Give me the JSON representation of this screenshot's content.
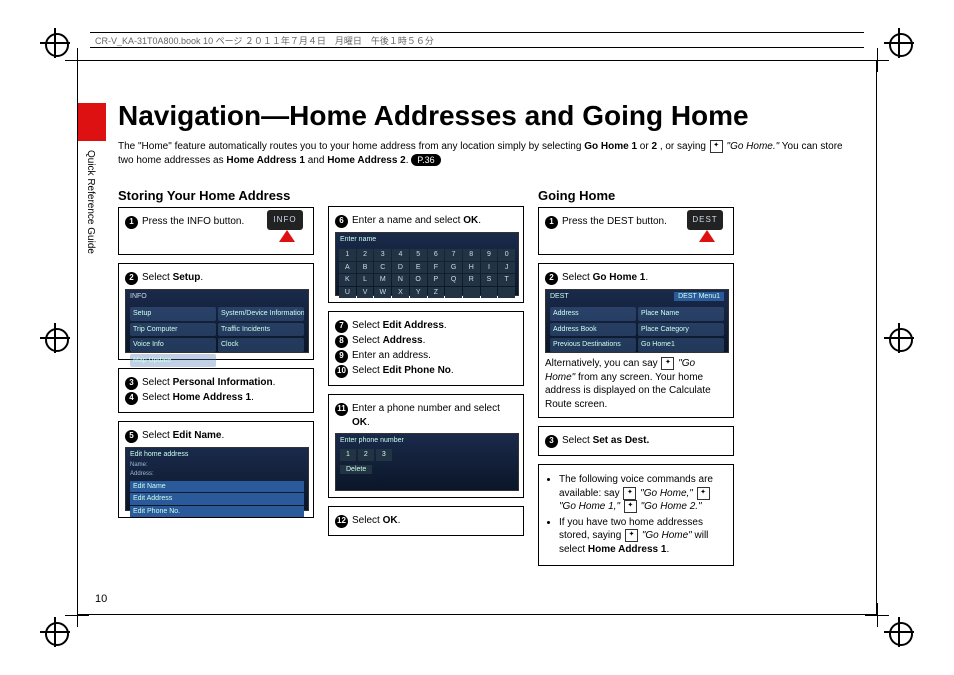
{
  "meta": {
    "header_text": "CR-V_KA-31T0A800.book  10 ページ  ２０１１年７月４日　月曜日　午後１時５６分",
    "side_tab": "Quick Reference Guide",
    "page_number": "10"
  },
  "title": "Navigation—Home Addresses and Going Home",
  "intro": {
    "line1a": "The \"Home\" feature automatically routes you to your home address from any location simply by selecting ",
    "b1": "Go Home 1",
    "mid1": " or ",
    "b2": "2",
    "mid2": ", or saying ",
    "say1": "\"Go Home.\"",
    "line2a": " You can store two home addresses as ",
    "b3": "Home Address 1",
    "mid3": " and ",
    "b4": "Home Address 2",
    "pill": "P.36"
  },
  "col1": {
    "heading": "Storing Your Home Address",
    "s1": "Press the INFO button.",
    "btn1": "INFO",
    "s2a": "Select ",
    "s2b": "Setup",
    "s2c": ".",
    "info_cells": [
      "Setup",
      "System/Device Information",
      "Trip Computer",
      "Traffic Incidents",
      "Voice Info",
      "Clock",
      "Map Update"
    ],
    "s3a": "Select ",
    "s3b": "Personal Information",
    "s3c": ".",
    "s4a": "Select ",
    "s4b": "Home Address 1",
    "s4c": ".",
    "s5a": "Select ",
    "s5b": "Edit Name",
    "s5c": ".",
    "edit_title": "Edit home address",
    "edit_rows": [
      "Edit Name",
      "Edit Address",
      "Edit Phone No."
    ]
  },
  "col2": {
    "s6a": "Enter a name and select ",
    "s6b": "OK",
    "s6c": ".",
    "kb_title": "Enter name",
    "kb": [
      "1",
      "2",
      "3",
      "4",
      "5",
      "6",
      "7",
      "8",
      "9",
      "0",
      "A",
      "B",
      "C",
      "D",
      "E",
      "F",
      "G",
      "H",
      "I",
      "J",
      "K",
      "L",
      "M",
      "N",
      "O",
      "P",
      "Q",
      "R",
      "S",
      "T",
      "U",
      "V",
      "W",
      "X",
      "Y",
      "Z",
      " ",
      " ",
      " ",
      " "
    ],
    "s7a": "Select ",
    "s7b": "Edit Address",
    "s7c": ".",
    "s8a": "Select ",
    "s8b": "Address",
    "s8c": ".",
    "s9": "Enter an address.",
    "s10a": "Select ",
    "s10b": "Edit Phone No",
    "s10c": ".",
    "s11a": "Enter a phone number and select ",
    "s11b": "OK",
    "s11c": ".",
    "ph_title": "Enter phone number",
    "s12a": "Select ",
    "s12b": "OK",
    "s12c": "."
  },
  "col3": {
    "heading": "Going Home",
    "s1": "Press the DEST button.",
    "btn1": "DEST",
    "s2a": "Select ",
    "s2b": "Go Home 1",
    "s2c": ".",
    "dest_title": "DEST Menu1",
    "dest_cells": [
      "Address",
      "Place Name",
      "Address Book",
      "Place Category",
      "Previous Destinations",
      "Go Home1"
    ],
    "alt1": "Alternatively, you can say ",
    "alt2": "\"Go Home\"",
    "alt3": " from any screen. Your home address is displayed on the Calculate Route screen.",
    "s3a": "Select ",
    "s3b": "Set as Dest.",
    "v1a": "The following voice commands are available: say ",
    "v1b": "\"Go Home,\"",
    "v1c": "\"Go Home 1,\"",
    "v1d": "\"Go Home 2.\"",
    "v2a": "If you have two home addresses stored, saying ",
    "v2b": "\"Go Home\"",
    "v2c": " will select ",
    "v2d": "Home Address 1",
    "v2e": "."
  }
}
